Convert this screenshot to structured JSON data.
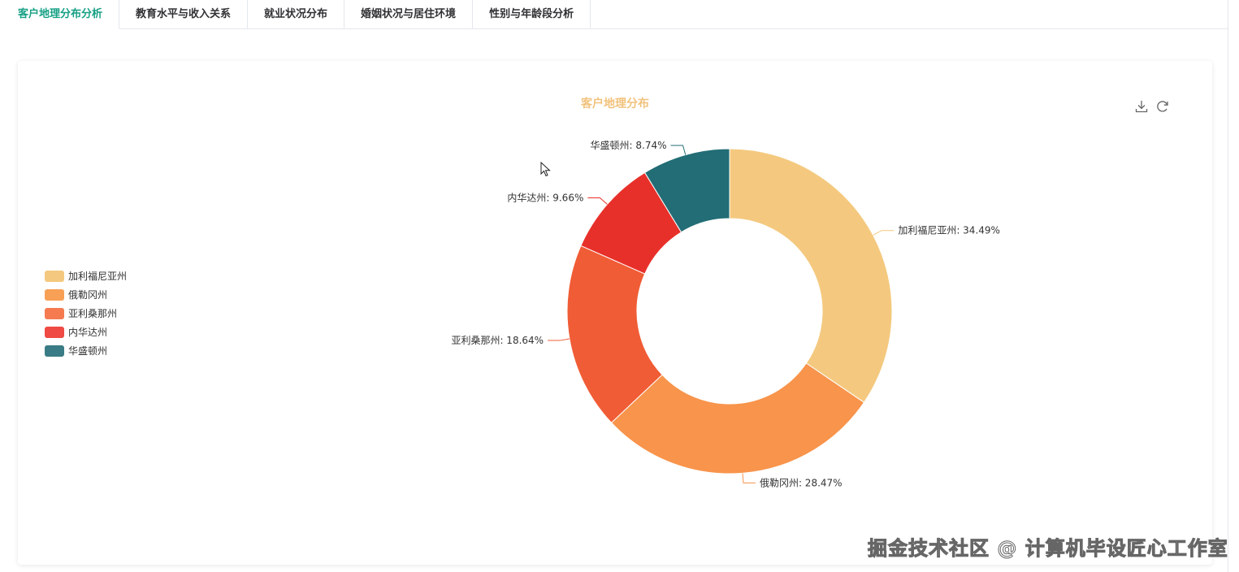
{
  "tabs": [
    {
      "label": "客户地理分布分析",
      "active": true
    },
    {
      "label": "教育水平与收入关系",
      "active": false
    },
    {
      "label": "就业状况分布",
      "active": false
    },
    {
      "label": "婚姻状况与居住环境",
      "active": false
    },
    {
      "label": "性别与年龄段分析",
      "active": false
    }
  ],
  "toolbox": {
    "download_icon": "download-icon",
    "refresh_icon": "refresh-icon"
  },
  "chart_data": {
    "type": "pie",
    "variant": "donut",
    "title": "客户地理分布",
    "legend_position": "left",
    "categories": [
      "加利福尼亚州",
      "俄勒冈州",
      "亚利桑那州",
      "内华达州",
      "华盛顿州"
    ],
    "values": [
      34.49,
      28.47,
      18.64,
      9.66,
      8.74
    ],
    "unit": "%",
    "labels": [
      "加利福尼亚州: 34.49%",
      "俄勒冈州: 28.47%",
      "亚利桑那州: 18.64%",
      "内华达州: 9.66%",
      "华盛顿州: 8.74%"
    ],
    "colors": [
      "#f4c97f",
      "#f8944b",
      "#f05c35",
      "#e8302a",
      "#226d76"
    ],
    "legend_colors": [
      "#f4c97f",
      "#f8a055",
      "#f57a50",
      "#ef4a43",
      "#3a7c85"
    ]
  },
  "watermark": "掘金技术社区 @ 计算机毕设匠心工作室"
}
